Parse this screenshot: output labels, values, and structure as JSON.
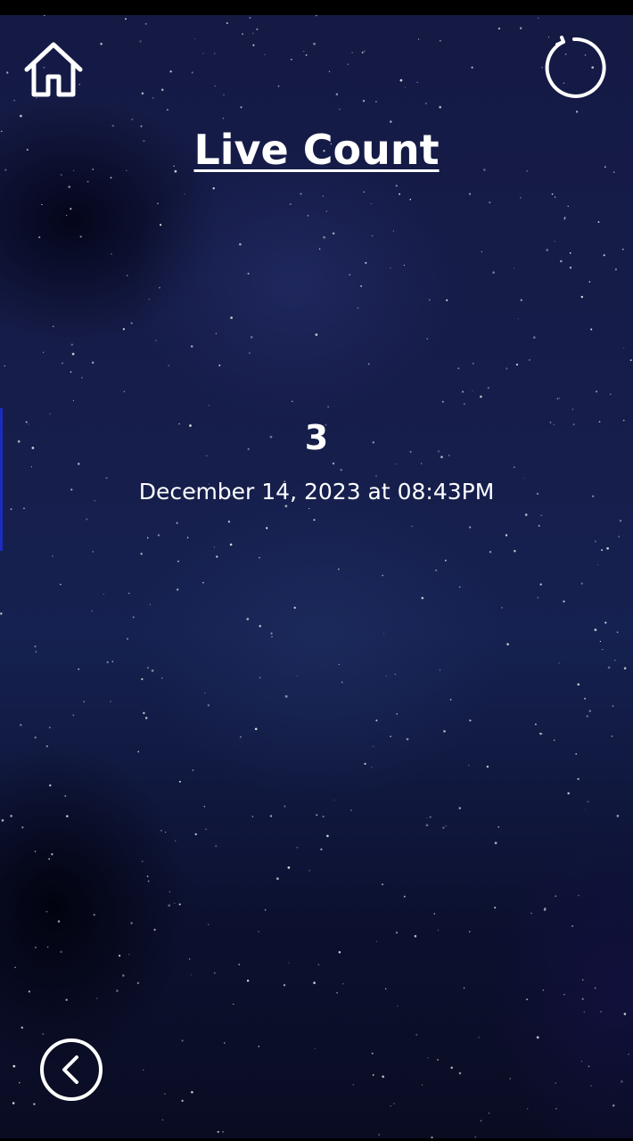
{
  "header": {
    "title": "Live Count",
    "home_icon": "home-icon",
    "refresh_icon": "refresh-icon"
  },
  "main": {
    "count": "3",
    "timestamp": "December 14, 2023 at 08:43PM"
  },
  "footer": {
    "back_icon": "chevron-left-icon"
  },
  "colors": {
    "text": "#ffffff",
    "background": "#161d4a"
  }
}
